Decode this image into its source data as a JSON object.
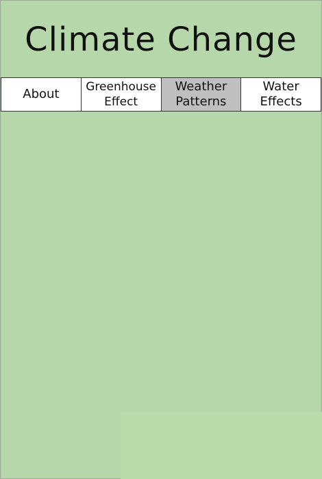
{
  "page": {
    "title": "Climate Change"
  },
  "nav": {
    "tabs": [
      {
        "label": "About"
      },
      {
        "label": "Greenhouse\nEffect"
      },
      {
        "label": "Weather\nPatterns",
        "active": true
      },
      {
        "label": "Water\nEffects"
      }
    ]
  },
  "colors": {
    "background": "#b5d7a9",
    "tab_active": "#bfbfbf",
    "tab_inactive": "#ffffff"
  }
}
